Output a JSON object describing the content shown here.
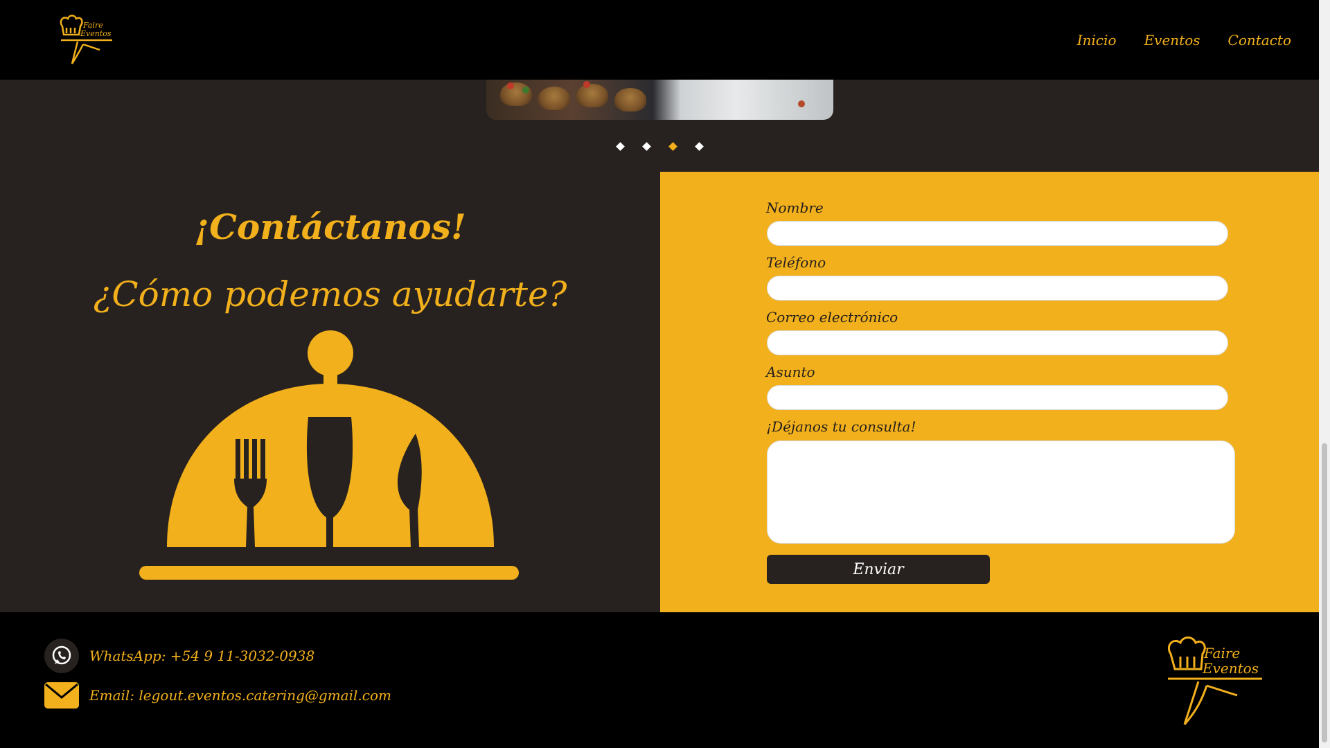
{
  "brand": {
    "logo_line1": "Faire",
    "logo_line2": "Eventos"
  },
  "nav": {
    "items": [
      "Inicio",
      "Eventos",
      "Contacto"
    ]
  },
  "carousel": {
    "slide_count": 4,
    "active_index": 2
  },
  "contact": {
    "title": "¡Contáctanos!",
    "subtitle": "¿Cómo podemos ayudarte?"
  },
  "form": {
    "fields": [
      {
        "label": "Nombre",
        "value": ""
      },
      {
        "label": "Teléfono",
        "value": ""
      },
      {
        "label": "Correo electrónico",
        "value": ""
      },
      {
        "label": "Asunto",
        "value": ""
      }
    ],
    "message_label": "¡Déjanos tu consulta!",
    "message_value": "",
    "submit_label": "Enviar"
  },
  "footer": {
    "whatsapp": "WhatsApp: +54 9 11-3032-0938",
    "email": "Email: legout.eventos.catering@gmail.com"
  },
  "colors": {
    "accent": "#f2b01c",
    "dark": "#27221f",
    "black": "#000000"
  }
}
